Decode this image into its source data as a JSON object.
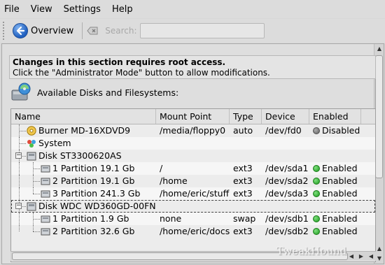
{
  "menubar": {
    "items": [
      {
        "label": "File"
      },
      {
        "label": "View"
      },
      {
        "label": "Settings"
      },
      {
        "label": "Help"
      }
    ]
  },
  "toolbar": {
    "overview_label": "Overview",
    "search_label": "Search:",
    "search_value": ""
  },
  "notice": {
    "title": "Changes in this section requires root access.",
    "body": "Click the \"Administrator Mode\" button to allow modifications."
  },
  "disks": {
    "title": "Available Disks and Filesystems:",
    "columns": [
      "Name",
      "Mount Point",
      "Type",
      "Device",
      "Enabled"
    ],
    "rows": [
      {
        "name": "Burner MD-16XDVD9",
        "mount": "/media/floppy0",
        "type": "auto",
        "device": "/dev/fd0",
        "enabled": "Disabled",
        "status": "off",
        "level": 1,
        "icon": "optical-drive-icon"
      },
      {
        "name": "System",
        "mount": "",
        "type": "",
        "device": "",
        "enabled": "",
        "status": "",
        "level": 1,
        "icon": "system-icon"
      },
      {
        "name": "Disk ST3300620AS",
        "mount": "",
        "type": "",
        "device": "",
        "enabled": "",
        "status": "",
        "level": 0,
        "icon": "hard-disk-icon",
        "expander": "−"
      },
      {
        "name": "1 Partition 19.1 Gb",
        "mount": "/",
        "type": "ext3",
        "device": "/dev/sda1",
        "enabled": "Enabled",
        "status": "on",
        "level": 2,
        "icon": "partition-icon"
      },
      {
        "name": "2 Partition 19.1 Gb",
        "mount": "/home",
        "type": "ext3",
        "device": "/dev/sda2",
        "enabled": "Enabled",
        "status": "on",
        "level": 2,
        "icon": "partition-icon"
      },
      {
        "name": "3 Partition 241.3 Gb",
        "mount": "/home/eric/stuff",
        "type": "ext3",
        "device": "/dev/sda3",
        "enabled": "Enabled",
        "status": "on",
        "level": 2,
        "icon": "partition-icon"
      },
      {
        "name": "Disk WDC WD360GD-00FN",
        "mount": "",
        "type": "",
        "device": "",
        "enabled": "",
        "status": "",
        "level": 0,
        "icon": "hard-disk-icon",
        "expander": "−"
      },
      {
        "name": "1 Partition 1.9 Gb",
        "mount": "none",
        "type": "swap",
        "device": "/dev/sdb1",
        "enabled": "Enabled",
        "status": "on",
        "level": 2,
        "icon": "partition-icon"
      },
      {
        "name": "2 Partition 32.6 Gb",
        "mount": "/home/eric/docs",
        "type": "ext3",
        "device": "/dev/sdb2",
        "enabled": "Enabled",
        "status": "on",
        "level": 2,
        "icon": "partition-icon"
      }
    ]
  },
  "watermark": "TweakHound"
}
